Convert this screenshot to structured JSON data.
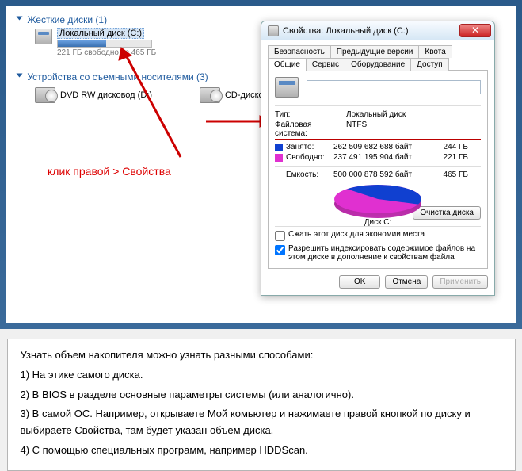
{
  "sections": {
    "hdd_title": "Жесткие диски (1)",
    "local_disk": {
      "name": "Локальный диск (C:)",
      "free_text": "221 ГБ свободно из 465 ГБ"
    },
    "removable_title": "Устройства со съемными носителями (3)",
    "dvd_name": "DVD RW дисковод (D:)",
    "cd_name": "CD-дисковод"
  },
  "hint_text": "клик правой > Свойства",
  "dialog": {
    "title": "Свойства: Локальный диск (C:)",
    "tabs_top": [
      "Безопасность",
      "Предыдущие версии",
      "Квота"
    ],
    "tabs_bottom": [
      "Общие",
      "Сервис",
      "Оборудование",
      "Доступ"
    ],
    "name_value": "",
    "type_label": "Тип:",
    "type_value": "Локальный диск",
    "fs_label": "Файловая система:",
    "fs_value": "NTFS",
    "used_label": "Занято:",
    "used_bytes": "262 509 682 688 байт",
    "used_gb": "244 ГБ",
    "free_label": "Свободно:",
    "free_bytes": "237 491 195 904 байт",
    "free_gb": "221 ГБ",
    "cap_label": "Емкость:",
    "cap_bytes": "500 000 878 592 байт",
    "cap_gb": "465 ГБ",
    "disk_label": "Диск C:",
    "clean_btn": "Очистка диска",
    "compress_chk": "Сжать этот диск для экономии места",
    "index_chk": "Разрешить индексировать содержимое файлов на этом диске в дополнение к свойствам файла",
    "ok": "OK",
    "cancel": "Отмена",
    "apply": "Применить"
  },
  "notes": {
    "intro": "Узнать объем накопителя можно узнать разными способами:",
    "n1": "1) На этике самого диска.",
    "n2": "2) В BIOS в разделе основные параметры системы (или аналогично).",
    "n3": "3) В самой ОС. Например, открываете Мой комьютер и нажимаете правой кнопкой по диску и выбираете Свойства, там будет указан объем диска.",
    "n4": "4) С помощью специальных программ, например HDDScan."
  },
  "chart_data": {
    "type": "pie",
    "title": "Диск C:",
    "series": [
      {
        "name": "Занято",
        "value": 262509682688,
        "gb": 244,
        "color": "#1040d0"
      },
      {
        "name": "Свободно",
        "value": 237491195904,
        "gb": 221,
        "color": "#e030d0"
      }
    ],
    "total_bytes": 500000878592,
    "total_gb": 465
  }
}
